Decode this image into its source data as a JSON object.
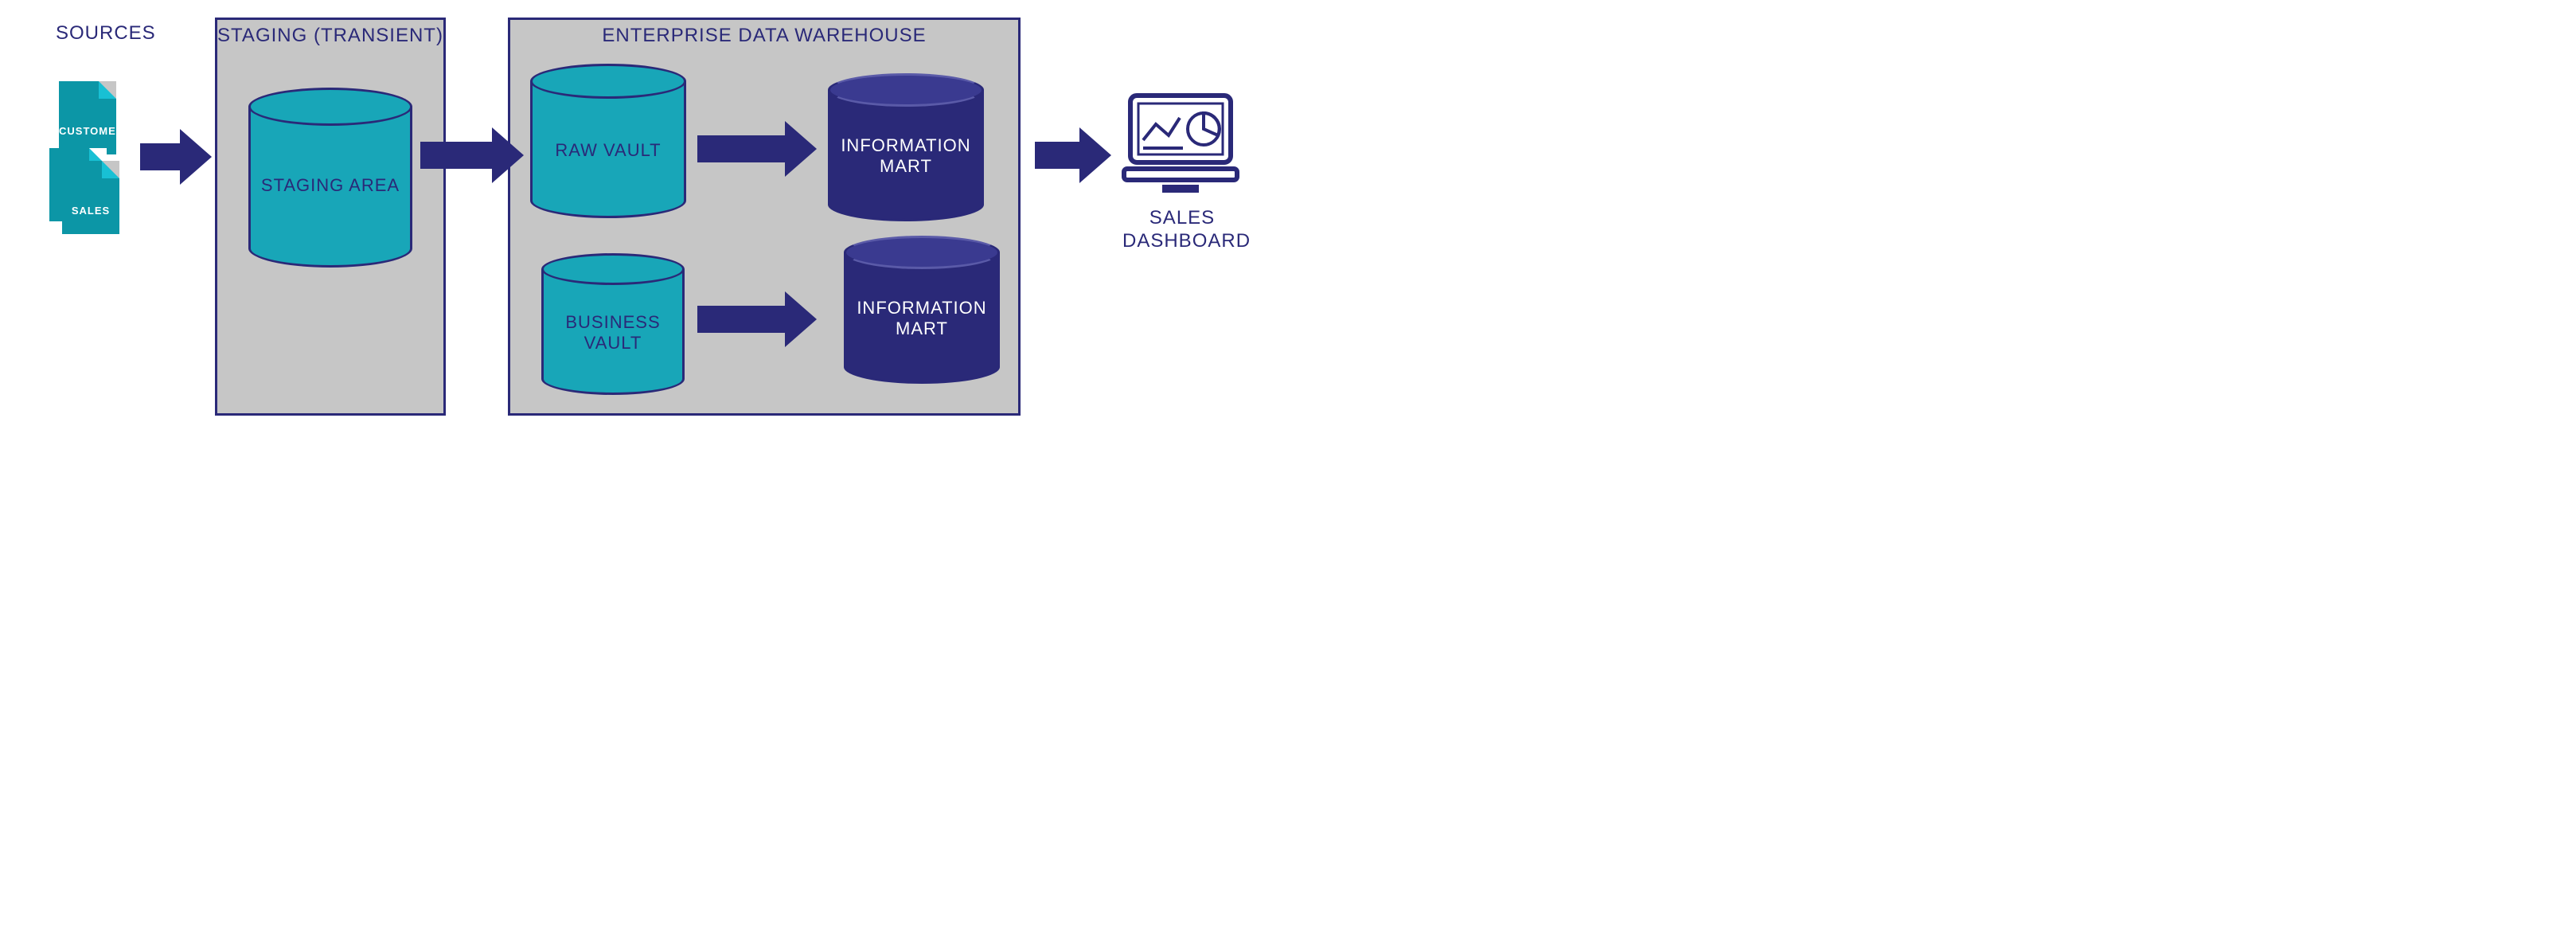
{
  "sources": {
    "title": "SOURCES",
    "doc1": "CUSTOMER",
    "doc2": "SALES"
  },
  "staging": {
    "title": "STAGING (TRANSIENT)",
    "cylinder": "STAGING AREA"
  },
  "edw": {
    "title": "ENTERPRISE DATA WAREHOUSE",
    "raw": "RAW VAULT",
    "business": "BUSINESS\nVAULT",
    "mart1": "INFORMATION\nMART",
    "mart2": "INFORMATION\nMART"
  },
  "output": {
    "label": "SALES\nDASHBOARD"
  },
  "colors": {
    "navy": "#2a2978",
    "teal": "#18a6b8",
    "grey": "#c6c6c6"
  }
}
